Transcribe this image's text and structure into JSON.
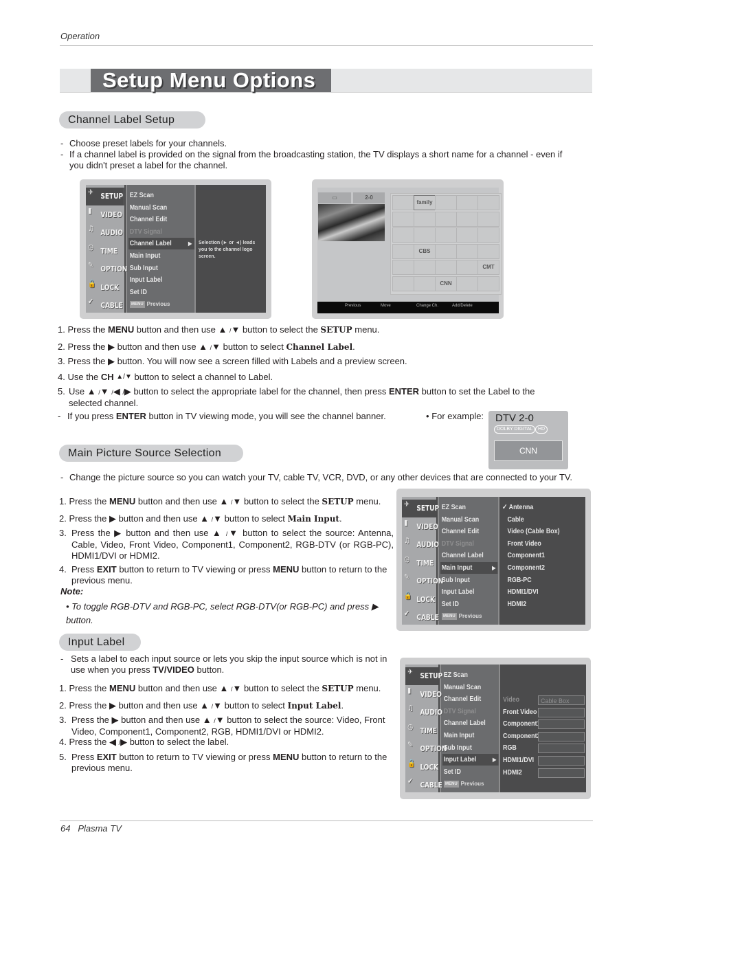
{
  "header": {
    "section": "Operation"
  },
  "page_title": "Setup Menu Options",
  "footer": {
    "page_number": "64",
    "product": "Plasma TV"
  },
  "symbols": {
    "up": "▲",
    "down": "▼",
    "left": "◀",
    "right": "▶",
    "slash": "/",
    "ch_updown": "▲/▼",
    "check": "✓",
    "bullet": "•"
  },
  "channel_label": {
    "heading": "Channel Label Setup",
    "intro": [
      "Choose preset labels for your channels.",
      "If a channel label is provided on the signal from the broadcasting station, the TV displays a short name for a channel - even if you didn't preset a label for the channel."
    ],
    "steps": {
      "s1": {
        "n": "1.",
        "a": "Press the ",
        "b": "MENU",
        "c": " button and then use ",
        "d": " button to select the ",
        "e": "SETUP",
        "f": " menu."
      },
      "s2": {
        "n": "2.",
        "a": "Press the ",
        "c": " button and then use ",
        "d": " button to select ",
        "e": "Channel Label",
        "f": "."
      },
      "s3": {
        "n": "3.",
        "a": "Press the ",
        "c": " button. You will now see a screen filled with Labels and a preview screen."
      },
      "s4": {
        "n": "4.",
        "a": "Use the ",
        "b": "CH ",
        "c": " button to select a channel to Label."
      },
      "s5": {
        "n": "5.",
        "a": "Use ",
        "c": " button to select the appropriate label for the channel, then press ",
        "b": "ENTER",
        "d": " button to set the Label to the selected channel."
      }
    },
    "tip": {
      "a": "If you press  ",
      "b": "ENTER",
      "c": "  button in TV viewing mode, you will see the channel banner."
    },
    "example_label": "For example:",
    "banner": {
      "channel": "DTV 2-0",
      "badges": [
        "DOLBY DIGITAL",
        "HD"
      ],
      "label": "CNN"
    }
  },
  "main_input": {
    "heading": "Main Picture Source Selection",
    "intro": "Change the picture source so you can watch your TV, cable TV, VCR, DVD, or any other devices that are connected to your TV.",
    "steps": {
      "s1": {
        "n": "1.",
        "a": "Press the ",
        "b": "MENU",
        "c": " button and then use ",
        "d": " button to select the ",
        "e": "SETUP",
        "f": " menu."
      },
      "s2": {
        "n": "2.",
        "a": "Press the ",
        "c": " button and then use ",
        "d": " button to select ",
        "e": "Main Input",
        "f": "."
      },
      "s3": {
        "n": "3.",
        "a": "Press the ",
        "c": " button and then use ",
        "d": " button to select the source: Antenna, Cable, Video, Front Video, Component1, Component2, RGB-DTV (or RGB-PC), HDMI1/DVI or HDMI2."
      },
      "s4": {
        "n": "4.",
        "a": "Press ",
        "b": "EXIT",
        "c": " button to return to TV viewing or press ",
        "d": "MENU",
        "e": " button to return to the previous menu."
      }
    },
    "note_title": "Note:",
    "note": {
      "a": "To toggle RGB-DTV and RGB-PC, select RGB-DTV(or RGB-PC) and press ",
      "b": "button."
    }
  },
  "input_label": {
    "heading": "Input Label",
    "intro": {
      "a": "Sets a label to each input source or lets you skip the input source which is not in use when you press ",
      "b": "TV/VIDEO",
      "c": " button."
    },
    "steps": {
      "s1": {
        "n": "1.",
        "a": "Press the ",
        "b": "MENU",
        "c": " button and then use ",
        "d": " button to select the ",
        "e": "SETUP",
        "f": " menu."
      },
      "s2": {
        "n": "2.",
        "a": "Press the ",
        "c": " button and then use ",
        "d": " button to select ",
        "e": "Input Label",
        "f": "."
      },
      "s3": {
        "n": "3.",
        "a": "Press the ",
        "c": " button and then use ",
        "d": " button to select the source: Video, Front Video, Component1, Component2, RGB, HDMI1/DVI or HDMI2."
      },
      "s4": {
        "n": "4.",
        "a": "Press the ",
        "c": " button to select the label."
      },
      "s5": {
        "n": "5.",
        "a": "Press ",
        "b": "EXIT",
        "c": " button to return to TV viewing or press ",
        "d": "MENU",
        "e": " button to return to the previous menu."
      }
    }
  },
  "osd": {
    "tabs": [
      "SETUP",
      "VIDEO",
      "AUDIO",
      "TIME",
      "OPTION",
      "LOCK",
      "CABLE"
    ],
    "items": [
      "EZ Scan",
      "Manual Scan",
      "Channel Edit",
      "DTV Signal",
      "Channel Label",
      "Main Input",
      "Sub Input",
      "Input Label",
      "Set ID"
    ],
    "preview_key": "MENU",
    "preview_label": "Previous",
    "channel_label_hint": "Selection (► or ◄) leads you to the channel logo screen.",
    "main_input_sources": [
      "Antenna",
      "Cable",
      "Video (Cable Box)",
      "Front Video",
      "Component1",
      "Component2",
      "RGB-PC",
      "HDMI1/DVI",
      "HDMI2"
    ],
    "main_input_selected": "Antenna",
    "input_label_sources": [
      "Video",
      "Front Video",
      "Component1",
      "Component2",
      "RGB",
      "HDMI1/DVI",
      "HDMI2"
    ],
    "input_label_values": [
      "Cable Box",
      "",
      "",
      "",
      "",
      "",
      ""
    ],
    "logo_screen": {
      "preview_channel": "2-0",
      "footer": [
        "Previous",
        "Move",
        "Change Ch.",
        "Add/Delete"
      ],
      "logos": [
        "",
        "family",
        "",
        "",
        "",
        "",
        "",
        "",
        "",
        "",
        "",
        "",
        "",
        "",
        "",
        "",
        "CBS",
        "",
        "",
        "",
        "",
        "",
        "",
        "",
        "CMT",
        "",
        "",
        "CNN",
        "",
        ""
      ]
    }
  }
}
